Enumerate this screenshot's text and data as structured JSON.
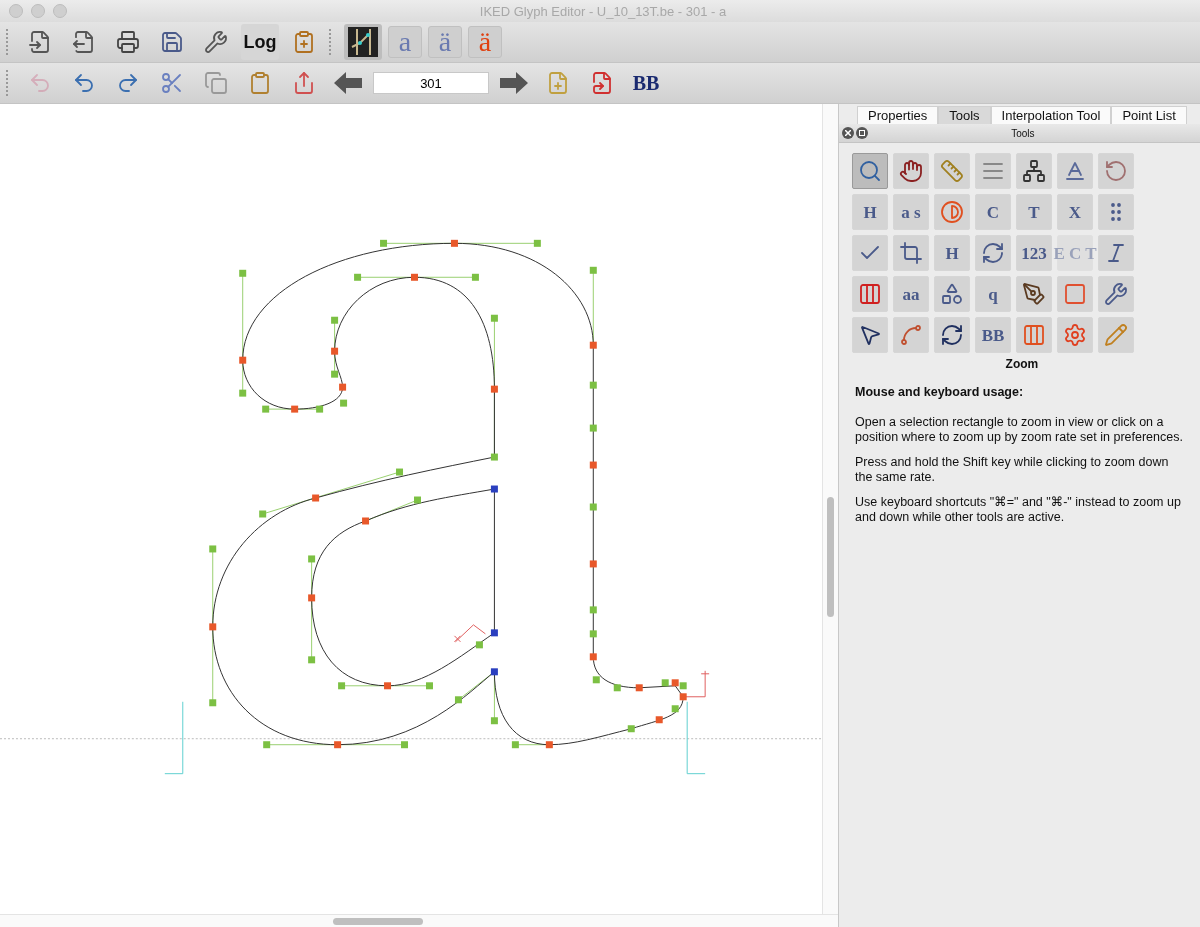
{
  "window": {
    "title": "IKED Glyph Editor - U_10_13T.be - 301 - a"
  },
  "toolbar_1": [
    {
      "kind": "grip"
    },
    {
      "kind": "icon",
      "selected": false
    },
    {
      "kind": "icon",
      "selected": false
    },
    {
      "kind": "icon",
      "selected": false
    },
    {
      "kind": "icon",
      "selected": false
    },
    {
      "kind": "icon",
      "selected": false
    },
    {
      "kind": "text",
      "label": "Log",
      "selected": false
    },
    {
      "kind": "icon",
      "selected": false
    },
    {
      "kind": "grip"
    },
    {
      "kind": "icon",
      "selected": true
    },
    {
      "kind": "glyph",
      "label": "a",
      "selected": false
    },
    {
      "kind": "glyph",
      "label": "ä",
      "selected": false
    },
    {
      "kind": "glyph",
      "label": "ä",
      "selected": false
    }
  ],
  "toolbar_2": [
    {
      "kind": "grip"
    },
    {
      "kind": "icon",
      "disabled": true
    },
    {
      "kind": "icon",
      "disabled": false
    },
    {
      "kind": "icon",
      "disabled": false
    },
    {
      "kind": "icon",
      "disabled": false
    },
    {
      "kind": "icon",
      "disabled": false
    },
    {
      "kind": "icon",
      "disabled": false
    },
    {
      "kind": "icon",
      "disabled": false
    },
    {
      "kind": "icon",
      "disabled": false
    },
    {
      "kind": "field",
      "value": "301"
    },
    {
      "kind": "icon",
      "disabled": false
    },
    {
      "kind": "icon",
      "disabled": false
    },
    {
      "kind": "icon",
      "disabled": false
    },
    {
      "kind": "glyph",
      "label": "BB",
      "disabled": false
    }
  ],
  "panel": {
    "tabs": [
      {
        "label": "Properties",
        "selected": false
      },
      {
        "label": "Tools",
        "selected": true
      },
      {
        "label": "Interpolation Tool",
        "selected": false
      },
      {
        "label": "Point List",
        "selected": false
      }
    ],
    "dock_title": "Tools",
    "tools": [
      {
        "selected": true,
        "disabled": false
      },
      {
        "selected": false,
        "disabled": false
      },
      {
        "selected": false,
        "disabled": false
      },
      {
        "selected": false,
        "disabled": false
      },
      {
        "selected": false,
        "disabled": false
      },
      {
        "selected": false,
        "disabled": false
      },
      {
        "selected": false,
        "disabled": false
      },
      {
        "label": "H",
        "selected": false,
        "disabled": false
      },
      {
        "label": "a s",
        "selected": false,
        "disabled": false
      },
      {
        "selected": false,
        "disabled": false
      },
      {
        "label": "C",
        "selected": false,
        "disabled": false
      },
      {
        "label": "T",
        "selected": false,
        "disabled": false
      },
      {
        "label": "X",
        "selected": false,
        "disabled": false
      },
      {
        "selected": false,
        "disabled": false
      },
      {
        "selected": false,
        "disabled": false
      },
      {
        "selected": false,
        "disabled": false
      },
      {
        "label": "H",
        "selected": false,
        "disabled": false
      },
      {
        "selected": false,
        "disabled": false
      },
      {
        "label": "123",
        "selected": false,
        "disabled": false
      },
      {
        "label": "E C T",
        "selected": false,
        "disabled": true
      },
      {
        "selected": false,
        "disabled": false
      },
      {
        "selected": false,
        "disabled": false
      },
      {
        "label": "aa",
        "selected": false,
        "disabled": false
      },
      {
        "selected": false,
        "disabled": false
      },
      {
        "label": "q",
        "selected": false,
        "disabled": false
      },
      {
        "selected": false,
        "disabled": false
      },
      {
        "selected": false,
        "disabled": false
      },
      {
        "selected": false,
        "disabled": false
      },
      {
        "selected": false,
        "disabled": false
      },
      {
        "selected": false,
        "disabled": false
      },
      {
        "selected": false,
        "disabled": false
      },
      {
        "label": "BB",
        "selected": false,
        "disabled": false
      },
      {
        "selected": false,
        "disabled": false
      },
      {
        "selected": false,
        "disabled": false
      },
      {
        "selected": false,
        "disabled": false
      }
    ],
    "tool_name": "Zoom",
    "help_title": "Mouse and keyboard usage:",
    "help_paragraphs": [
      "Open a selection rectangle to zoom in view or click on a position where to zoom up by zoom rate set in preferences.",
      "Press and hold the Shift key while clicking to zoom down the same rate.",
      "Use keyboard shortcuts \"⌘=\" and \"⌘-\" instead to zoom up and down while other tools are active."
    ]
  }
}
